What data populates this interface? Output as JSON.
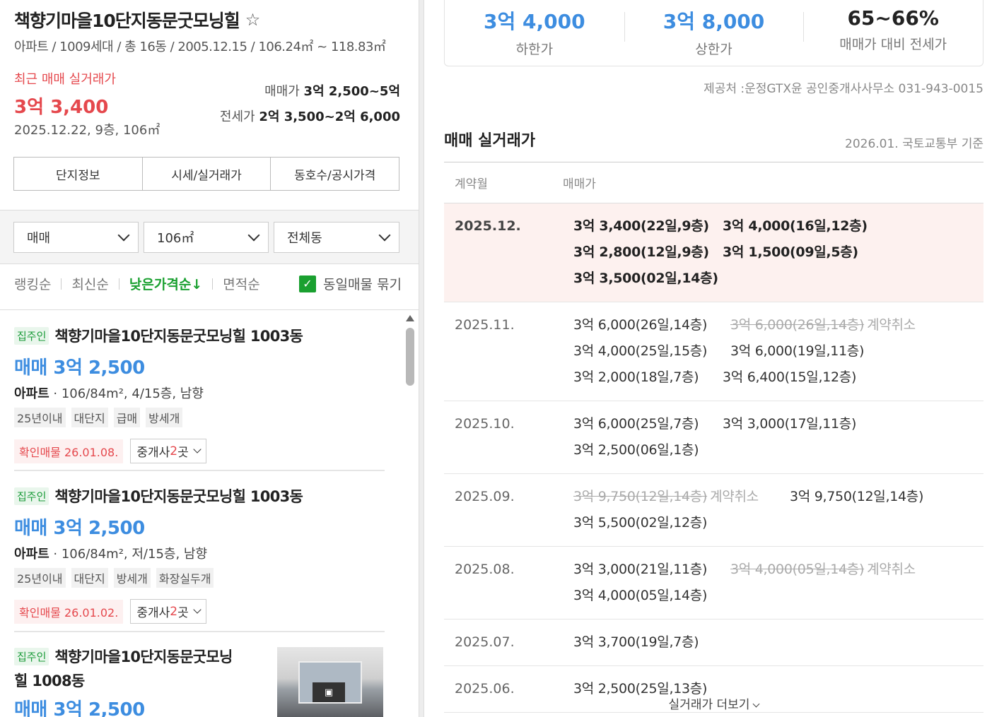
{
  "complex": {
    "title": "책향기마을10단지동문굿모닝힐",
    "meta": "아파트 / 1009세대 / 총 16동 / 2005.12.15 / 106.24㎡ ~ 118.83㎡",
    "recent_label": "최근 매매 실거래가",
    "recent_price": "3억 3,400",
    "recent_date": "2025.12.22, 9층, 106㎡",
    "sale_label": "매매가",
    "sale_range": "3억 2,500~5억",
    "jeonse_label": "전세가",
    "jeonse_range": "2억 3,500~2억 6,000"
  },
  "tabs": [
    "단지정보",
    "시세/실거래가",
    "동호수/공시가격"
  ],
  "filters": {
    "trade_type": "매매",
    "area": "106㎡",
    "dong": "전체동"
  },
  "sort": {
    "options": [
      "랭킹순",
      "최신순",
      "낮은가격순↓",
      "면적순"
    ],
    "merge_label": "동일매물 묶기"
  },
  "listings": [
    {
      "badge": "집주인",
      "name": "책향기마을10단지동문굿모닝힐 1003동",
      "price": "매매 3억 2,500",
      "type": "아파트",
      "spec": " · 106/84m², 4/15층, 남향",
      "tags": [
        "25년이내",
        "대단지",
        "급매",
        "방세개"
      ],
      "verified": "확인매물 26.01.08.",
      "broker_prefix": "중개사 ",
      "broker_count": "2",
      "broker_suffix": "곳"
    },
    {
      "badge": "집주인",
      "name": "책향기마을10단지동문굿모닝힐 1003동",
      "price": "매매 3억 2,500",
      "type": "아파트",
      "spec": " · 106/84m², 저/15층, 남향",
      "tags": [
        "25년이내",
        "대단지",
        "방세개",
        "화장실두개"
      ],
      "verified": "확인매물 26.01.02.",
      "broker_prefix": "중개사 ",
      "broker_count": "2",
      "broker_suffix": "곳"
    },
    {
      "badge": "집주인",
      "name_line1": "책향기마을10단지동문굿모닝",
      "name_line2": "힐 1008동",
      "price": "매매 3억 2,500"
    }
  ],
  "stats": [
    {
      "value": "3억 4,000",
      "label": "하한가"
    },
    {
      "value": "3억 8,000",
      "label": "상한가"
    },
    {
      "value": "65~66%",
      "label": "매매가 대비 전세가"
    }
  ],
  "source": "제공처 :운정GTX윤 공인중개사사무소 031-943-0015",
  "deals_section": {
    "title": "매매 실거래가",
    "basis": "2026.01. 국토교통부 기준",
    "col_month": "계약월",
    "col_price": "매매가",
    "more_label": "실거래가 더보기",
    "rows": [
      {
        "month": "2025.12.",
        "deals": [
          "3억 3,400(22일,9층)",
          "3억 4,000(16일,12층)",
          "3억 2,800(12일,9층)",
          "3억 1,500(09일,5층)",
          "3억 3,500(02일,14층)"
        ]
      },
      {
        "month": "2025.11.",
        "deals": [
          "3억 6,000(26일,14층)",
          "3억 6,000(26일,14층)",
          "3억 4,000(25일,15층)",
          "3억 6,000(19일,11층)",
          "3억 2,000(18일,7층)",
          "3억 6,400(15일,12층)"
        ]
      },
      {
        "month": "2025.10.",
        "deals": [
          "3억 6,000(25일,7층)",
          "3억 3,000(17일,11층)",
          "3억 2,500(06일,1층)"
        ]
      },
      {
        "month": "2025.09.",
        "deals": [
          "3억 9,750(12일,14층)",
          "3억 9,750(12일,14층)",
          "3억 5,500(02일,12층)"
        ]
      },
      {
        "month": "2025.08.",
        "deals": [
          "3억 3,000(21일,11층)",
          "3억 4,000(05일,14층)",
          "3억 4,000(05일,14층)"
        ]
      },
      {
        "month": "2025.07.",
        "deals": [
          "3억 3,700(19일,7층)"
        ]
      },
      {
        "month": "2025.06.",
        "deals": [
          "3억 2,500(25일,13층)"
        ]
      }
    ],
    "cancel_label": "계약취소"
  },
  "icons": {
    "favorite": "star-outline-icon",
    "check": "check-icon",
    "chevron": "chevron-down-icon",
    "scroll_up": "arrow-up-icon"
  },
  "colors": {
    "accent_green": "#1aa030",
    "price_blue": "#3d8de0",
    "alert_red": "#e5484d"
  }
}
